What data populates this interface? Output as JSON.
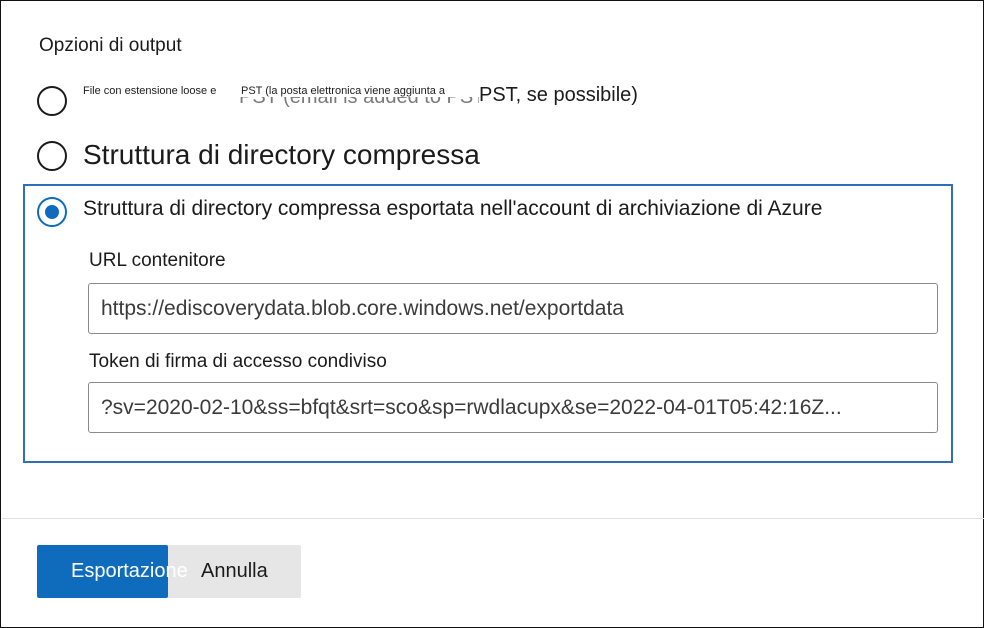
{
  "output_options": {
    "title": "Opzioni di output",
    "options": [
      {
        "label_part1": "File con estensione loose e",
        "label_part2": "PST (la posta elettronica viene aggiunta a",
        "label_part3": "PST, se possibile)",
        "ghost_text": "PST (email is added to PST, when possible)",
        "selected": false
      },
      {
        "label": "Struttura di directory compressa",
        "selected": false
      },
      {
        "label": "Struttura di directory compressa esportata nell'account di archiviazione di Azure",
        "selected": true
      }
    ]
  },
  "azure": {
    "container_url_label": "URL contenitore",
    "container_url_value": "https://ediscoverydata.blob.core.windows.net/exportdata",
    "sas_token_label": "Token di firma di accesso condiviso",
    "sas_token_value": "?sv=2020-02-10&ss=bfqt&srt=sco&sp=rwdlacupx&se=2022-04-01T05:42:16Z..."
  },
  "footer": {
    "export_label": "Esportazione",
    "cancel_label": "Annulla"
  },
  "colors": {
    "accent": "#0f6cbd",
    "box_border": "#2f6fb6"
  }
}
